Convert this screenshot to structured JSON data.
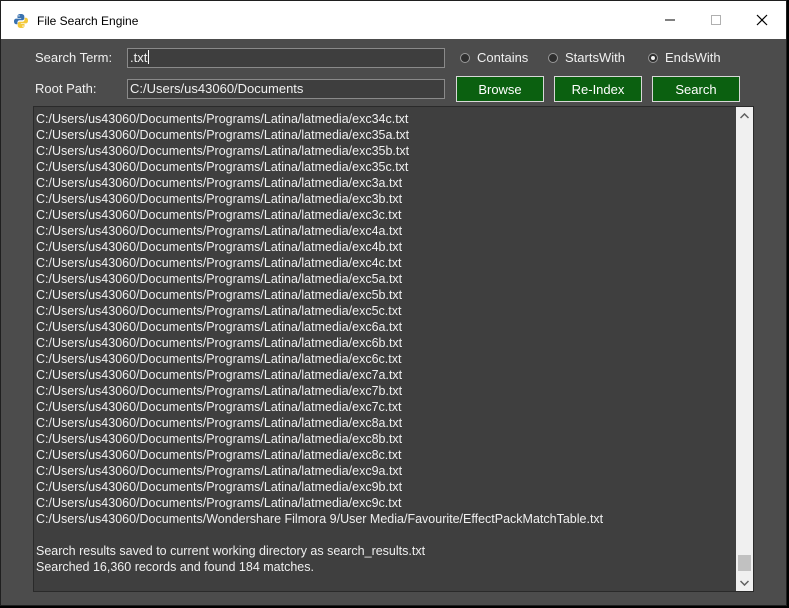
{
  "window": {
    "title": "File Search Engine",
    "icon": "python-icon"
  },
  "form": {
    "search_label": "Search Term:",
    "search_value": ".txt",
    "root_label": "Root Path:",
    "root_value": "C:/Users/us43060/Documents"
  },
  "match_mode": {
    "options": [
      {
        "label": "Contains",
        "selected": false
      },
      {
        "label": "StartsWith",
        "selected": false
      },
      {
        "label": "EndsWith",
        "selected": true
      }
    ]
  },
  "buttons": {
    "browse": "Browse",
    "reindex": "Re-Index",
    "search": "Search"
  },
  "colors": {
    "button_green": "#0b6010",
    "background": "#4c4c4c",
    "results_bg": "#3f3f3f"
  },
  "results": {
    "lines": [
      "C:/Users/us43060/Documents/Programs/Latina/latmedia/exc34c.txt",
      "C:/Users/us43060/Documents/Programs/Latina/latmedia/exc35a.txt",
      "C:/Users/us43060/Documents/Programs/Latina/latmedia/exc35b.txt",
      "C:/Users/us43060/Documents/Programs/Latina/latmedia/exc35c.txt",
      "C:/Users/us43060/Documents/Programs/Latina/latmedia/exc3a.txt",
      "C:/Users/us43060/Documents/Programs/Latina/latmedia/exc3b.txt",
      "C:/Users/us43060/Documents/Programs/Latina/latmedia/exc3c.txt",
      "C:/Users/us43060/Documents/Programs/Latina/latmedia/exc4a.txt",
      "C:/Users/us43060/Documents/Programs/Latina/latmedia/exc4b.txt",
      "C:/Users/us43060/Documents/Programs/Latina/latmedia/exc4c.txt",
      "C:/Users/us43060/Documents/Programs/Latina/latmedia/exc5a.txt",
      "C:/Users/us43060/Documents/Programs/Latina/latmedia/exc5b.txt",
      "C:/Users/us43060/Documents/Programs/Latina/latmedia/exc5c.txt",
      "C:/Users/us43060/Documents/Programs/Latina/latmedia/exc6a.txt",
      "C:/Users/us43060/Documents/Programs/Latina/latmedia/exc6b.txt",
      "C:/Users/us43060/Documents/Programs/Latina/latmedia/exc6c.txt",
      "C:/Users/us43060/Documents/Programs/Latina/latmedia/exc7a.txt",
      "C:/Users/us43060/Documents/Programs/Latina/latmedia/exc7b.txt",
      "C:/Users/us43060/Documents/Programs/Latina/latmedia/exc7c.txt",
      "C:/Users/us43060/Documents/Programs/Latina/latmedia/exc8a.txt",
      "C:/Users/us43060/Documents/Programs/Latina/latmedia/exc8b.txt",
      "C:/Users/us43060/Documents/Programs/Latina/latmedia/exc8c.txt",
      "C:/Users/us43060/Documents/Programs/Latina/latmedia/exc9a.txt",
      "C:/Users/us43060/Documents/Programs/Latina/latmedia/exc9b.txt",
      "C:/Users/us43060/Documents/Programs/Latina/latmedia/exc9c.txt",
      "C:/Users/us43060/Documents/Wondershare Filmora 9/User Media/Favourite/EffectPackMatchTable.txt"
    ],
    "saved_message": "Search results saved to current working directory as search_results.txt",
    "summary": "Searched 16,360 records and found 184 matches."
  }
}
